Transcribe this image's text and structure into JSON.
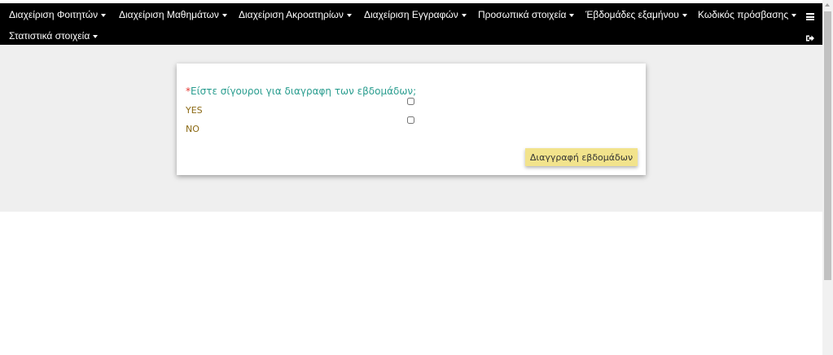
{
  "nav": {
    "items": [
      {
        "label": "Διαχείριση Φοιτητών"
      },
      {
        "label": "Διαχείριση Μαθημάτων"
      },
      {
        "label": "Διαχείριση Ακροατηρίων"
      },
      {
        "label": "Διαχείριση Εγγραφών"
      },
      {
        "label": "Προσωπικά στοιχεία"
      },
      {
        "label": "Έβδομάδες εξαμήνου"
      },
      {
        "label": "Κωδικός πρόσβασης"
      },
      {
        "label": "Στατιστικά στοιχεία"
      }
    ]
  },
  "form": {
    "required_mark": "*",
    "question": "Είστε σίγουροι για διαγραφη των εβδομάδων;",
    "options": [
      {
        "label": "YES",
        "checked": false
      },
      {
        "label": "NO",
        "checked": false
      }
    ],
    "submit_label": "Διαγγραφή εβδομάδων"
  },
  "colors": {
    "navbar": "#000000",
    "question": "#2a9d8f",
    "required": "#e53935",
    "option_label": "#8b6914",
    "button": "#f2e38c"
  }
}
